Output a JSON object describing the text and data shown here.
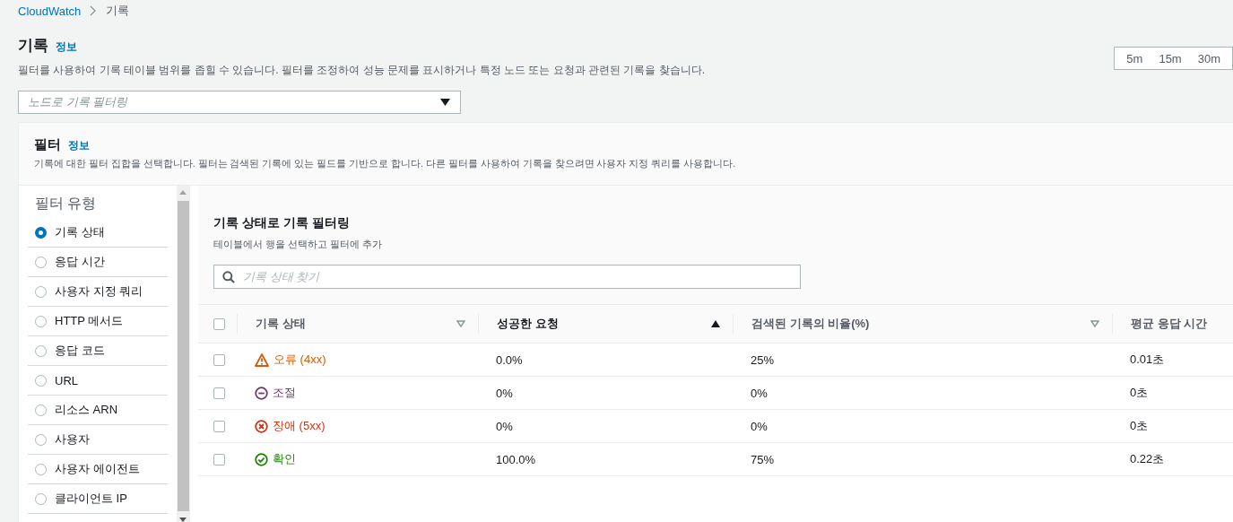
{
  "breadcrumb": [
    {
      "label": "CloudWatch",
      "current": false
    },
    {
      "label": "기록",
      "current": true
    }
  ],
  "header": {
    "title": "기록",
    "info": "정보",
    "description": "필터를 사용하여 기록 테이블 범위를 좁힐 수 있습니다. 필터를 조정하여 성능 문제를 표시하거나 특정 노드 또는 요청과 관련된 기록을 찾습니다."
  },
  "node_filter": {
    "placeholder": "노드로 기록 필터링"
  },
  "time_range": [
    "5m",
    "15m",
    "30m"
  ],
  "filter_panel": {
    "title": "필터",
    "info": "정보",
    "description": "기록에 대한 필터 집합을 선택합니다. 필터는 검색된 기록에 있는 필드를 기반으로 합니다. 다른 필터를 사용하여 기록을 찾으려면 사용자 지정 쿼리를 사용합니다."
  },
  "filter_types": {
    "title": "필터 유형",
    "items": [
      {
        "label": "기록 상태",
        "selected": true
      },
      {
        "label": "응답 시간",
        "selected": false
      },
      {
        "label": "사용자 지정 쿼리",
        "selected": false
      },
      {
        "label": "HTTP 메서드",
        "selected": false
      },
      {
        "label": "응답 코드",
        "selected": false
      },
      {
        "label": "URL",
        "selected": false
      },
      {
        "label": "리소스 ARN",
        "selected": false
      },
      {
        "label": "사용자",
        "selected": false
      },
      {
        "label": "사용자 에이전트",
        "selected": false
      },
      {
        "label": "클라이언트 IP",
        "selected": false
      }
    ]
  },
  "status_filter": {
    "title": "기록 상태로 기록 필터링",
    "subtitle": "테이블에서 행을 선택하고 필터에 추가",
    "search": {
      "placeholder": "기록 상태 찾기"
    }
  },
  "table": {
    "select_all_checked": false,
    "columns": [
      {
        "label": "기록 상태",
        "sorted": false
      },
      {
        "label": "성공한 요청",
        "sorted": true
      },
      {
        "label": "검색된 기록의 비율(%)",
        "sorted": false
      },
      {
        "label": "평균 응답 시간"
      }
    ],
    "rows": [
      {
        "checked": false,
        "kind": "error",
        "status": "오류 (4xx)",
        "success": "0.0%",
        "share": "25%",
        "avg": "0.01초"
      },
      {
        "checked": false,
        "kind": "throttle",
        "status": "조절",
        "success": "0%",
        "share": "0%",
        "avg": "0초"
      },
      {
        "checked": false,
        "kind": "fault",
        "status": "장애 (5xx)",
        "success": "0%",
        "share": "0%",
        "avg": "0초"
      },
      {
        "checked": false,
        "kind": "ok",
        "status": "확인",
        "success": "100.0%",
        "share": "75%",
        "avg": "0.22초"
      }
    ]
  }
}
